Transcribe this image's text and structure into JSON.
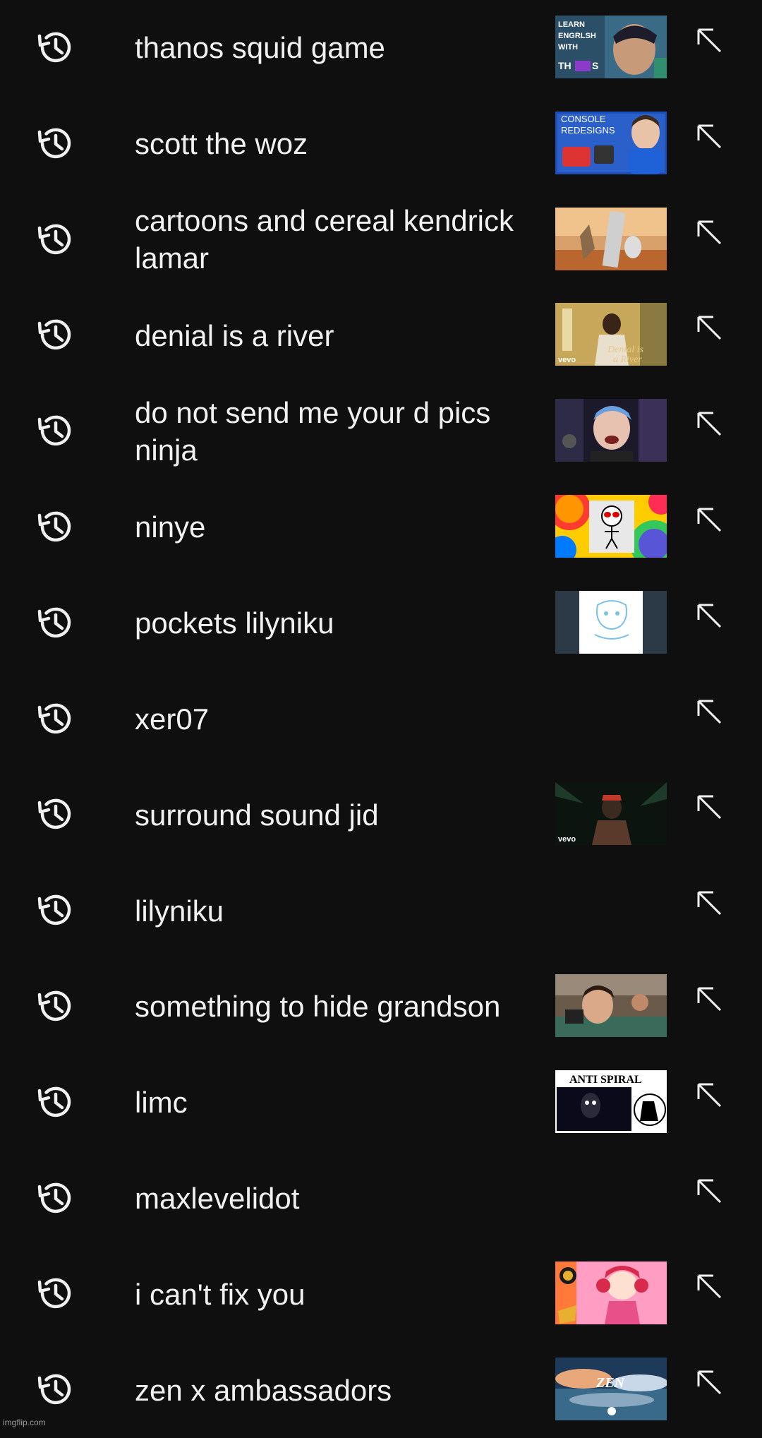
{
  "suggestions": [
    {
      "query": "thanos squid game",
      "thumbnail": "learn-english-with-thanos",
      "thumb_text": [
        "LEARN",
        "ENGRLSH",
        "WITH",
        "TH",
        "S"
      ]
    },
    {
      "query": "scott the woz",
      "thumbnail": "console-redesigns",
      "thumb_text": [
        "CONSOLE",
        "REDESIGNS"
      ]
    },
    {
      "query": "cartoons and cereal kendrick lamar",
      "thumbnail": "cartoon-desert"
    },
    {
      "query": "denial is a river",
      "thumbnail": "denial-is-a-river-vevo",
      "thumb_text": [
        "Denial is",
        "a River",
        "vevo"
      ]
    },
    {
      "query": "do not send me your d pics ninja",
      "thumbnail": "streamer-face"
    },
    {
      "query": "ninye",
      "thumbnail": "rainbow-stickman"
    },
    {
      "query": "pockets lilyniku",
      "thumbnail": "lilyniku-sketch"
    },
    {
      "query": "xer07",
      "thumbnail": ""
    },
    {
      "query": "surround sound jid",
      "thumbnail": "surround-sound-vevo",
      "thumb_text": [
        "vevo"
      ]
    },
    {
      "query": "lilyniku",
      "thumbnail": ""
    },
    {
      "query": "something to hide grandson",
      "thumbnail": "grandson-video"
    },
    {
      "query": "limc",
      "thumbnail": "anti-spiral",
      "thumb_text": [
        "ANTI SPIRAL"
      ]
    },
    {
      "query": "maxlevelidot",
      "thumbnail": ""
    },
    {
      "query": "i can't fix you",
      "thumbnail": "circus-baby"
    },
    {
      "query": "zen x ambassadors",
      "thumbnail": "zen-sky",
      "thumb_text": [
        "ZEN"
      ]
    }
  ],
  "watermark": "imgflip.com",
  "icons": {
    "history": "history-icon",
    "fill": "north-west-arrow-icon"
  }
}
